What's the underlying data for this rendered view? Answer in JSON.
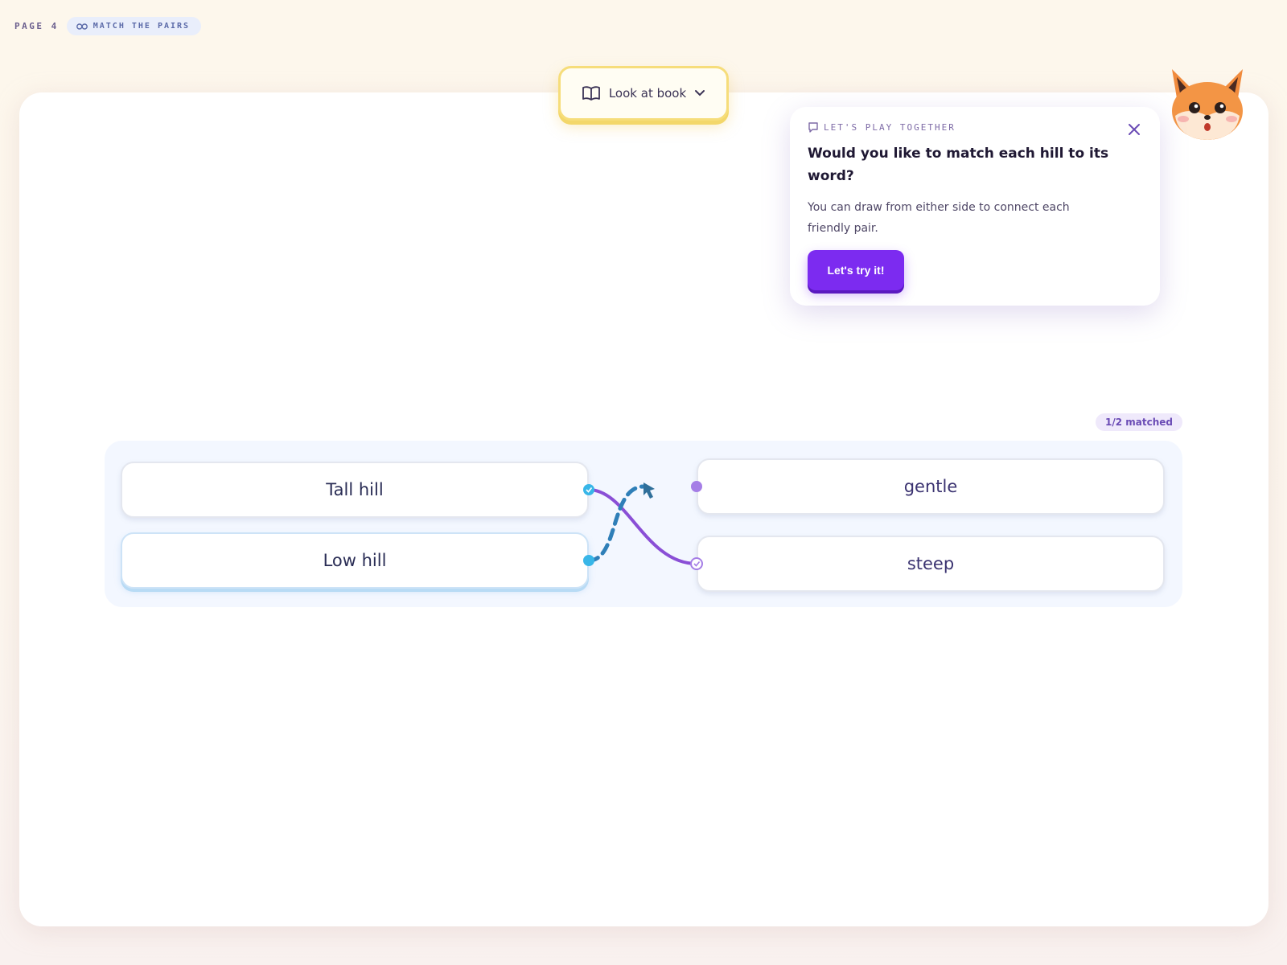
{
  "header": {
    "page_label": "PAGE 4",
    "activity_label": "MATCH THE PAIRS",
    "activity_icon": "link-icon"
  },
  "toolbar": {
    "book_button_label": "Look at book",
    "book_icon": "book-icon",
    "dropdown_icon": "chevron-down-icon"
  },
  "mascot": {
    "name": "fox-icon"
  },
  "tip": {
    "eyebrow": "LET'S PLAY TOGETHER",
    "title": "Would you like to match each hill to its word?",
    "body": "You can draw from either side to connect each friendly pair.",
    "button_label": "Let's try it!",
    "close_icon": "close-icon"
  },
  "matching": {
    "progress": "1/2 matched",
    "left_items": [
      "Tall hill",
      "Low hill"
    ],
    "right_items": [
      "gentle",
      "steep"
    ],
    "matched_pair": [
      "Tall hill",
      "steep"
    ],
    "in_progress_from": "Low hill"
  },
  "colors": {
    "accent_purple": "#7c2bf0",
    "match_line": "#8a4fd6",
    "drag_line": "#2f7fb8",
    "book_border": "#f6dd7a"
  }
}
